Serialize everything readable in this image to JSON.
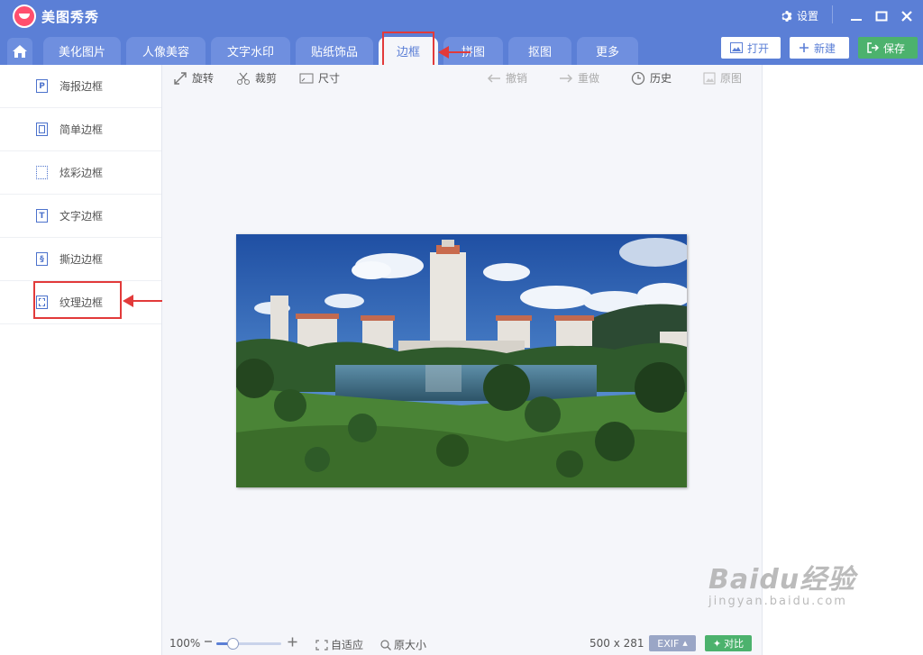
{
  "titlebar": {
    "app_title": "美图秀秀",
    "settings_label": "设置",
    "accent_color": "#5b7fd6"
  },
  "tabs": [
    {
      "label": "美化图片"
    },
    {
      "label": "人像美容"
    },
    {
      "label": "文字水印"
    },
    {
      "label": "贴纸饰品"
    },
    {
      "label": "边框",
      "active": true
    },
    {
      "label": "拼图"
    },
    {
      "label": "抠图"
    },
    {
      "label": "更多"
    }
  ],
  "toolbar_right": {
    "open_label": "打开",
    "new_label": "新建",
    "save_label": "保存"
  },
  "sidebar": {
    "items": [
      {
        "label": "海报边框",
        "icon": "poster-frame-icon"
      },
      {
        "label": "简单边框",
        "icon": "simple-frame-icon"
      },
      {
        "label": "炫彩边框",
        "icon": "colorful-frame-icon"
      },
      {
        "label": "文字边框",
        "icon": "text-frame-icon"
      },
      {
        "label": "撕边边框",
        "icon": "torn-edge-frame-icon"
      },
      {
        "label": "纹理边框",
        "icon": "texture-frame-icon",
        "highlighted": true
      }
    ]
  },
  "edit_tools": {
    "rotate": "旋转",
    "crop": "裁剪",
    "size": "尺寸",
    "undo": "撤销",
    "redo": "重做",
    "history": "历史",
    "original": "原图"
  },
  "statusbar": {
    "zoom": "100%",
    "zoom_fraction": 0.25,
    "fit": "自适应",
    "actual_size": "原大小",
    "dimensions": "500 x 281",
    "exif": "EXIF",
    "compare": "对比"
  },
  "watermark": {
    "main": "Baidu经验",
    "sub": "jingyan.baidu.com"
  }
}
